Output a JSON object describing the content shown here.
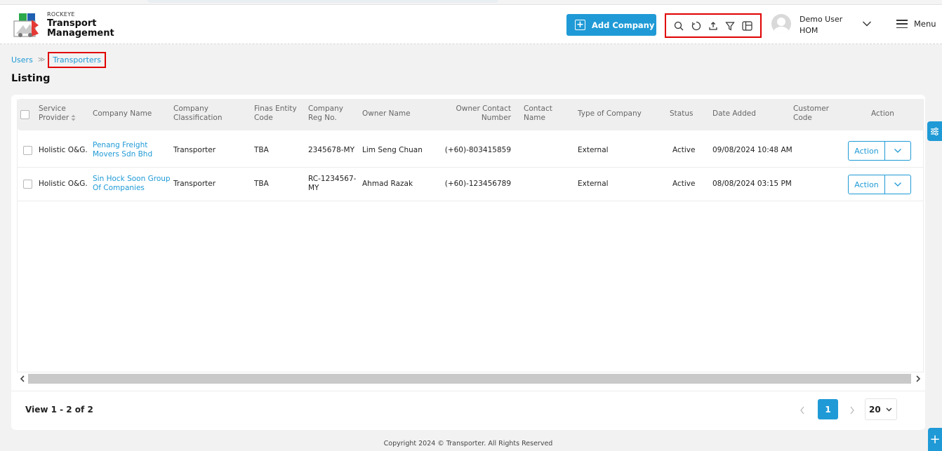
{
  "brand": {
    "small": "ROCKEYE",
    "line1": "Transport",
    "line2": "Management"
  },
  "header": {
    "add_company_label": "Add Company",
    "tool_icons": [
      "search-icon",
      "refresh-icon",
      "upload-icon",
      "filter-icon",
      "columns-icon"
    ],
    "user_name": "Demo User",
    "user_role": "HOM",
    "menu_label": "Menu"
  },
  "breadcrumb": {
    "parent": "Users",
    "current": "Transporters"
  },
  "page_title": "Listing",
  "table": {
    "headers": {
      "service_provider": [
        "Service",
        "Provider"
      ],
      "company_name": "Company Name",
      "company_classification": [
        "Company",
        "Classification"
      ],
      "finas_entity_code": [
        "Finas Entity",
        "Code"
      ],
      "company_reg_no": [
        "Company",
        "Reg No."
      ],
      "owner_name": "Owner Name",
      "owner_contact_number": [
        "Owner Contact",
        "Number"
      ],
      "contact_name": [
        "Contact",
        "Name"
      ],
      "type_of_company": "Type of Company",
      "status": "Status",
      "date_added": "Date Added",
      "customer_code": [
        "Customer",
        "Code"
      ],
      "action": "Action"
    },
    "rows": [
      {
        "service_provider": "Holistic O&G.",
        "company_name": [
          "Penang Freight",
          "Movers Sdn Bhd"
        ],
        "company_classification": "Transporter",
        "finas_entity_code": "TBA",
        "company_reg_no": [
          "2345678-MY"
        ],
        "owner_name": "Lim Seng Chuan",
        "owner_contact_number": "(+60)-803415859",
        "contact_name": "",
        "type_of_company": "External",
        "status": "Active",
        "date_added": "09/08/2024 10:48 AM",
        "customer_code": "",
        "action_label": "Action"
      },
      {
        "service_provider": "Holistic O&G.",
        "company_name": [
          "Sin Hock Soon Group",
          "Of Companies"
        ],
        "company_classification": "Transporter",
        "finas_entity_code": "TBA",
        "company_reg_no": [
          "RC-1234567-",
          "MY"
        ],
        "owner_name": "Ahmad Razak",
        "owner_contact_number": "(+60)-123456789",
        "contact_name": "",
        "type_of_company": "External",
        "status": "Active",
        "date_added": "08/08/2024 03:15 PM",
        "customer_code": "",
        "action_label": "Action"
      }
    ]
  },
  "pagination": {
    "view_text": "View 1 - 2 of 2",
    "current_page": "1",
    "page_size": "20"
  },
  "footer": {
    "copyright": "Copyright 2024 © Transporter. All Rights Reserved"
  },
  "colors": {
    "accent": "#1f9ad6",
    "highlight": "#e00000"
  }
}
